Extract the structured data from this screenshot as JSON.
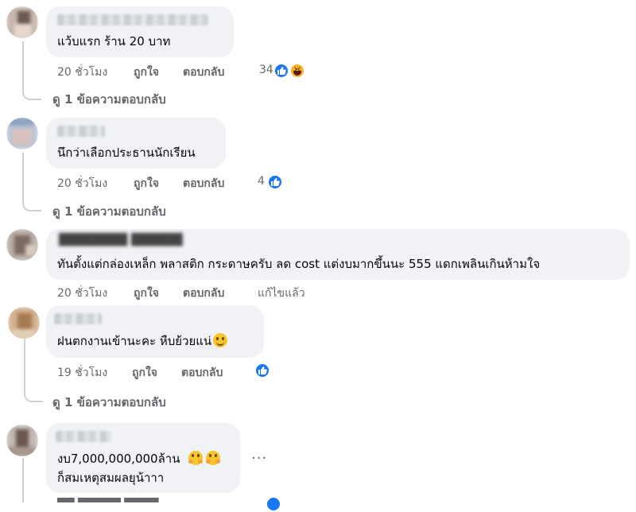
{
  "comments": [
    {
      "text": "แว้บแรก ร้าน 20 บาท",
      "time": "20 ชั่วโมง",
      "like": "ถูกใจ",
      "reply": "ตอบกลับ",
      "reaction_count": "34",
      "reactions": [
        "like-icon",
        "haha-icon"
      ],
      "view_replies": "ดู 1 ข้อความตอบกลับ"
    },
    {
      "text": "นึกว่าเลือกประธานนักเรียน",
      "time": "20 ชั่วโมง",
      "like": "ถูกใจ",
      "reply": "ตอบกลับ",
      "reaction_count": "4",
      "reactions": [
        "like-icon"
      ],
      "view_replies": "ดู 1 ข้อความตอบกลับ"
    },
    {
      "text": "ทันตั้งแต่กล่องเหล็ก พลาสติก กระดาษครับ ลด cost แต่งบมากขึ้นนะ 555 แดกเพลินเกินห้ามใจ",
      "time": "20 ชั่วโมง",
      "like": "ถูกใจ",
      "reply": "ตอบกลับ",
      "edited": "แก้ไขแล้ว"
    },
    {
      "text": "ฝนตกงานเข้านะคะ หืบย้วยแน่",
      "time": "19 ชั่วโมง",
      "like": "ถูกใจ",
      "reply": "ตอบกลับ",
      "reactions": [
        "like-icon"
      ],
      "view_replies": "ดู 1 ข้อความตอบกลับ"
    },
    {
      "text_line1": "งบ7,000,000,000ล้าน",
      "text_line2": "ก็สมเหตุสมผลยุน้าาา",
      "more": "···"
    }
  ],
  "colors": {
    "bubble": "#f0f2f5",
    "meta": "#65676b",
    "like_blue": "#1877f2",
    "thread_line": "#ced0d4"
  }
}
